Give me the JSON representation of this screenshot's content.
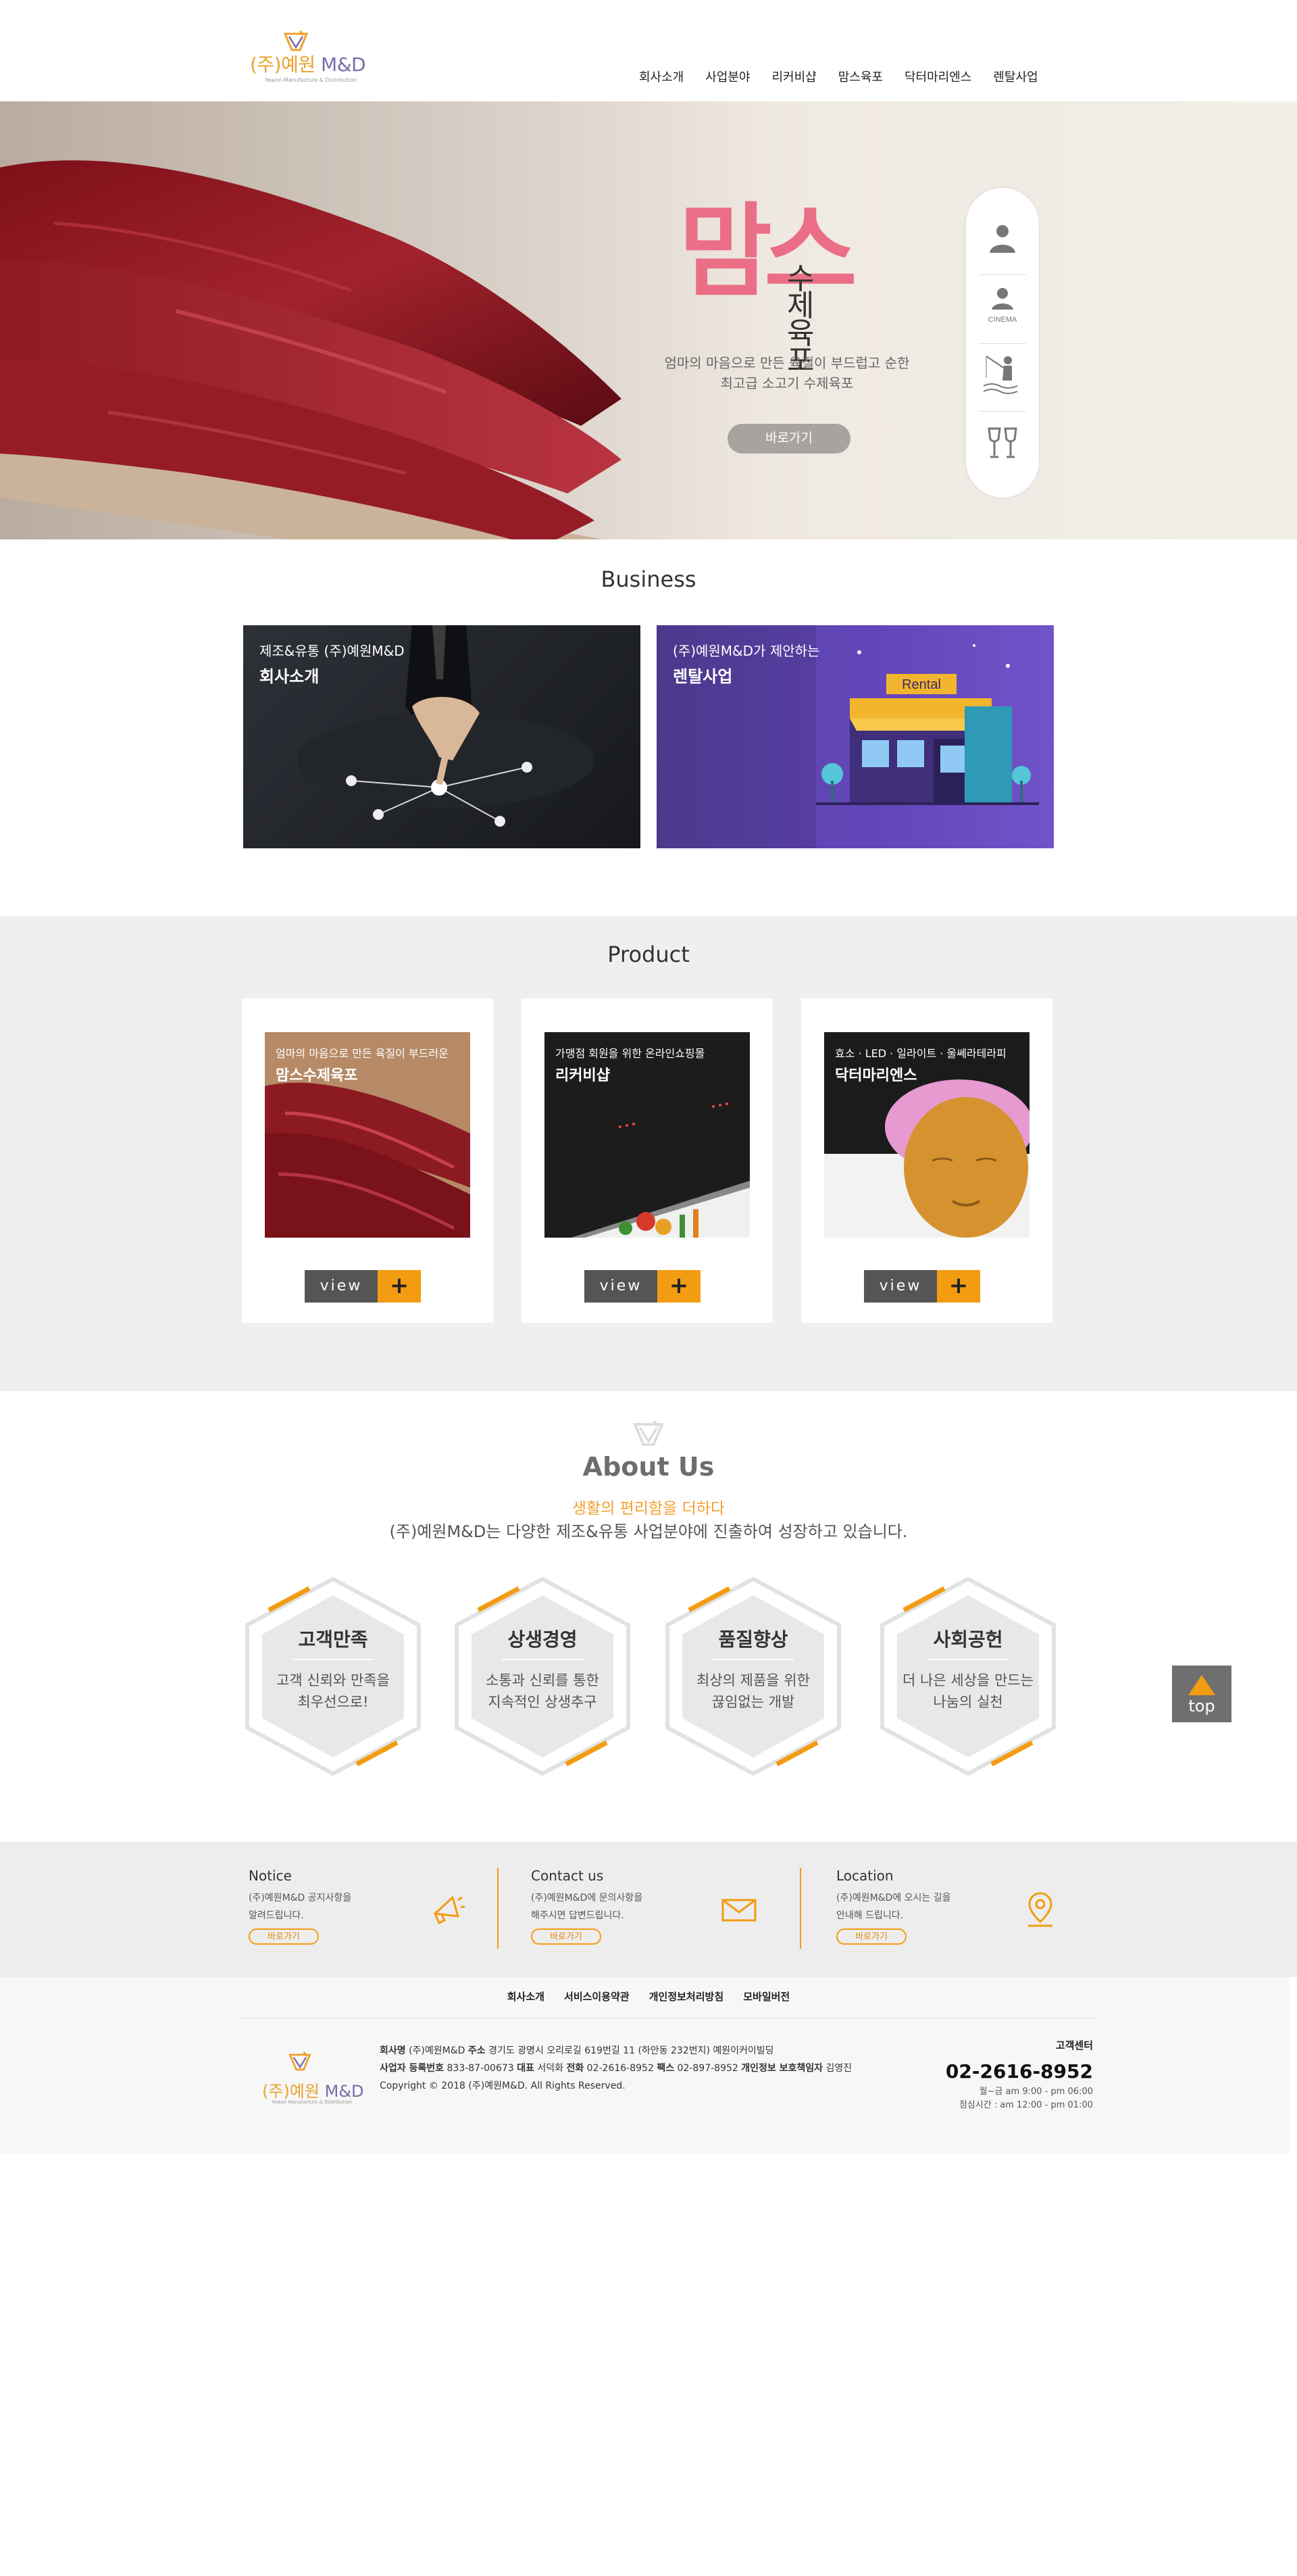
{
  "brand": {
    "name_ko": "(주)예원",
    "name_en": "M&D",
    "tagline": "Yewon Manufacture & Distribution"
  },
  "nav": [
    "회사소개",
    "사업분야",
    "리커비샵",
    "맘스육포",
    "닥터마리엔스",
    "렌탈사업"
  ],
  "hero": {
    "title_big": "맘스",
    "title_small": "수제육포",
    "desc_line1": "엄마의 마음으로 만든 육질이 부드럽고 순한",
    "desc_line2": "최고급 소고기 수제육포",
    "button": "바로가기",
    "quick_icons": [
      "person-icon",
      "cinema-icon",
      "fishing-icon",
      "wine-glass-icon"
    ],
    "quick_cinema_label": "CINEMA"
  },
  "business": {
    "title": "Business",
    "cards": [
      {
        "small": "제조&유통 (주)예원M&D",
        "big": "회사소개"
      },
      {
        "small": "(주)예원M&D가 제안하는",
        "big": "렌탈사업",
        "sign": "Rental"
      }
    ]
  },
  "product": {
    "title": "Product",
    "cards": [
      {
        "small": "엄마의 마음으로 만든 육질이 부드러운",
        "big": "맘스수제육포"
      },
      {
        "small": "가맹점 회원을 위한 온라인쇼핑몰",
        "big": "리커비샵"
      },
      {
        "small": "효소 · LED · 일라이트 · 울쎄라테라피",
        "big": "닥터마리엔스"
      }
    ],
    "view_label": "view",
    "plus_label": "+"
  },
  "about": {
    "title": "About Us",
    "subtitle": "생활의 편리함을 더하다",
    "desc": "(주)예원M&D는 다양한 제조&유통 사업분야에 진출하여 성장하고 있습니다.",
    "values": [
      {
        "title": "고객만족",
        "line1": "고객 신뢰와 만족을",
        "line2": "최우선으로!"
      },
      {
        "title": "상생경영",
        "line1": "소통과 신뢰를 통한",
        "line2": "지속적인 상생추구"
      },
      {
        "title": "품질향상",
        "line1": "최상의 제품을 위한",
        "line2": "끊임없는 개발"
      },
      {
        "title": "사회공헌",
        "line1": "더 나은 세상을 만드는",
        "line2": "나눔의 실천"
      }
    ]
  },
  "top_button": "top",
  "info": [
    {
      "title": "Notice",
      "line1": "(주)예원M&D 공지사항을",
      "line2": "알려드립니다.",
      "button": "바로가기",
      "icon": "megaphone-icon"
    },
    {
      "title": "Contact us",
      "line1": "(주)예원M&D에 문의사항을",
      "line2": "해주시면 답변드립니다.",
      "button": "바로가기",
      "icon": "mail-icon"
    },
    {
      "title": "Location",
      "line1": "(주)예원M&D에 오시는 길을",
      "line2": "안내해 드립니다.",
      "button": "바로가기",
      "icon": "location-pin-icon"
    }
  ],
  "footer": {
    "links": [
      "회사소개",
      "서비스이용약관",
      "개인정보처리방침",
      "모바일버전"
    ],
    "company_label": "회사명",
    "company": "(주)예원M&D",
    "address_label": "주소",
    "address": "경기도 광명시 오리로길 619번길 11 (하안동 232번지) 예원이커이빌딩",
    "bizno_label": "사업자 등록번호",
    "bizno": "833-87-00673",
    "ceo_label": "대표",
    "ceo": "서덕화",
    "tel_label": "전화",
    "tel": "02-2616-8952",
    "fax_label": "팩스",
    "fax": "02-897-8952",
    "privacy_label": "개인정보 보호책임자",
    "privacy": "김영진",
    "copyright": "Copyright © 2018 (주)예원M&D. All Rights Reserved.",
    "cs_label": "고객센터",
    "cs_number": "02-2616-8952",
    "cs_hours1": "월~금 am 9:00 - pm 06:00",
    "cs_hours2": "점심시간 : am 12:00 - pm 01:00"
  },
  "colors": {
    "accent": "#f39c12",
    "brand_pink": "#ea6f86",
    "rental_purple": "#5b3fa8"
  }
}
